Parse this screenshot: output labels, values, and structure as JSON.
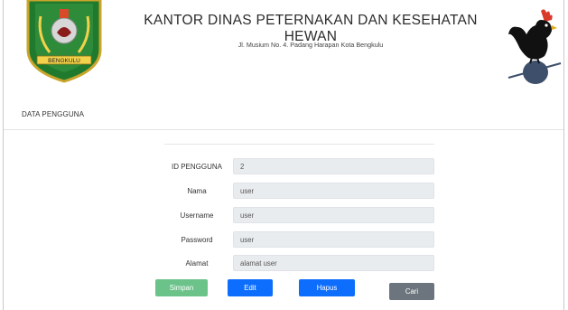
{
  "header": {
    "title": "KANTOR DINAS PETERNAKAN DAN KESEHATAN HEWAN",
    "address": "Jl. Musium No. 4. Padang Harapan Kota Bengkulu",
    "logo_left_text": "BENGKULU"
  },
  "section": {
    "title": "DATA PENGGUNA"
  },
  "form": {
    "fields": [
      {
        "label": "ID PENGGUNA",
        "value": "2"
      },
      {
        "label": "Nama",
        "value": "user"
      },
      {
        "label": "Username",
        "value": "user"
      },
      {
        "label": "Password",
        "value": "user"
      },
      {
        "label": "Alamat",
        "value": "alamat user"
      }
    ]
  },
  "buttons": {
    "save": "Simpan",
    "edit": "Edit",
    "delete": "Hapus",
    "search": "Cari"
  },
  "colors": {
    "save": "#6cc38a",
    "primary": "#0d6efd",
    "secondary": "#6c757d",
    "input_bg": "#e9ecef"
  },
  "icons": {
    "left_logo": "bengkulu-coat-of-arms-icon",
    "right_logo": "rooster-icon"
  }
}
